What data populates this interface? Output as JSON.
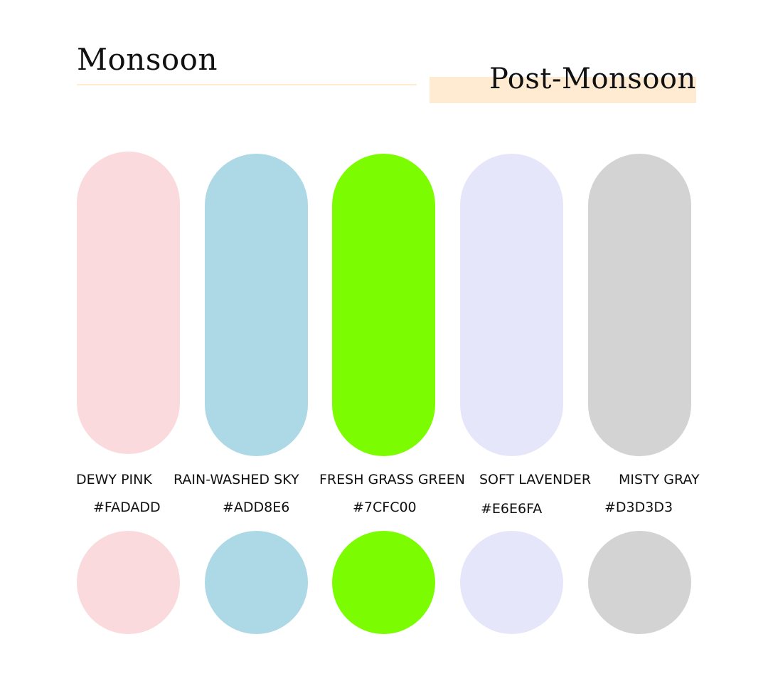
{
  "titles": {
    "left": "Monsoon",
    "right": "Post-Monsoon"
  },
  "accent_color": "#FFEBD2",
  "swatches": [
    {
      "name": "DEWY PINK",
      "hex": "#FADADD",
      "color": "#FADADD"
    },
    {
      "name": "RAIN-WASHED SKY",
      "hex": "#ADD8E6",
      "color": "#ADD8E6"
    },
    {
      "name": "FRESH GRASS GREEN",
      "hex": "#7CFC00",
      "color": "#7CFC00"
    },
    {
      "name": "SOFT LAVENDER",
      "hex": "#E6E6FA",
      "color": "#E6E6FA"
    },
    {
      "name": "MISTY GRAY",
      "hex": "#D3D3D3",
      "color": "#D3D3D3"
    }
  ]
}
